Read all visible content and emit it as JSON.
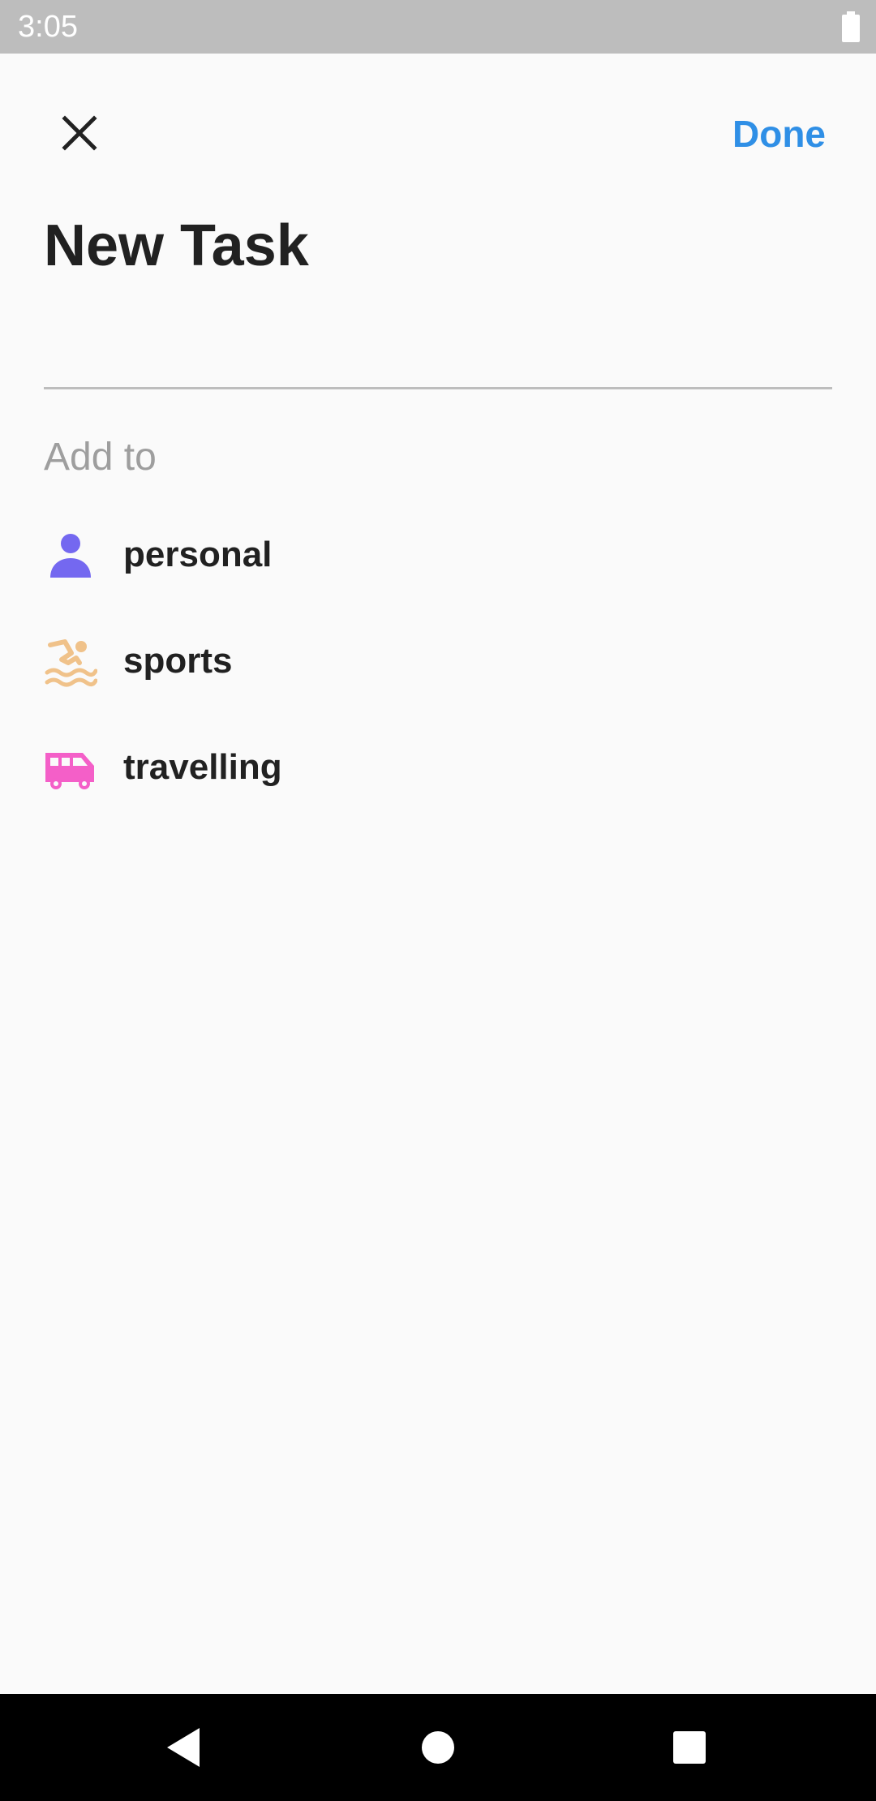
{
  "status_bar": {
    "time": "3:05",
    "battery_icon": "battery-full-icon"
  },
  "header": {
    "close_icon": "close-icon",
    "done_label": "Done",
    "done_color": "#2f8fe6"
  },
  "page": {
    "title": "New Task"
  },
  "task_input": {
    "value": "",
    "placeholder": ""
  },
  "add_to": {
    "label": "Add to",
    "items": [
      {
        "label": "personal",
        "icon": "person-icon",
        "color": "#7468f0"
      },
      {
        "label": "sports",
        "icon": "swimming-icon",
        "color": "#f0c28a"
      },
      {
        "label": "travelling",
        "icon": "van-icon",
        "color": "#f45fc8"
      }
    ]
  },
  "nav_bar": {
    "back_icon": "back-icon",
    "home_icon": "home-icon",
    "recents_icon": "recents-icon"
  }
}
